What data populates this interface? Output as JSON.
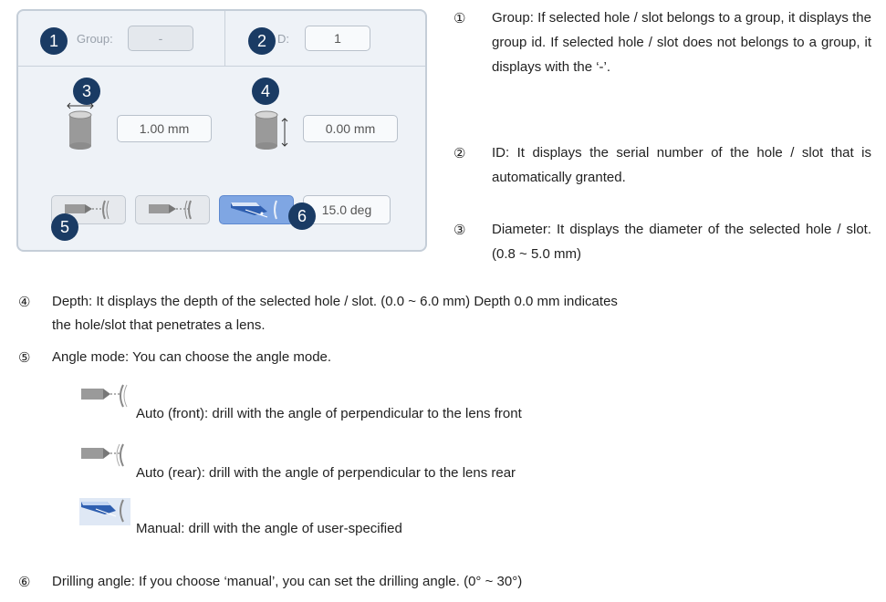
{
  "panel": {
    "group_label": "Group:",
    "group_value": "-",
    "id_label": "D:",
    "id_value": "1",
    "diameter_value": "1.00 mm",
    "depth_value": "0.00 mm",
    "angle_value": "15.0 deg",
    "badges": [
      "1",
      "2",
      "3",
      "4",
      "5",
      "6"
    ],
    "colors": {
      "badge": "#1a3b64",
      "active_button": "#7fa6e3",
      "panel_bg": "#eef2f7"
    }
  },
  "descriptions": [
    {
      "num": "①",
      "text": "Group: If selected hole / slot belongs to a group, it displays the group id. If selected hole / slot does not belongs to a group, it displays with the ‘-’."
    },
    {
      "num": "②",
      "text": "ID: It displays the serial number of the hole / slot that is automatically granted."
    },
    {
      "num": "③",
      "text": "Diameter: It displays the diameter of the selected hole / slot. (0.8 ~ 5.0 mm)"
    },
    {
      "num": "④",
      "line1": "Depth: It displays the depth of the selected hole / slot. (0.0 ~ 6.0 mm)  Depth 0.0 mm indicates",
      "line2": "the hole/slot that penetrates a lens."
    },
    {
      "num": "⑤",
      "text": "Angle mode: You can choose the angle mode."
    },
    {
      "num": "⑥",
      "text": "Drilling angle: If you choose ‘manual’, you can set the drilling angle. (0° ~ 30°)"
    }
  ],
  "angle_modes": [
    {
      "icon": "auto-front-icon",
      "text": "Auto (front): drill with the angle of perpendicular to the lens front"
    },
    {
      "icon": "auto-rear-icon",
      "text": "Auto (rear): drill with the angle of perpendicular to the lens rear"
    },
    {
      "icon": "manual-angle-icon",
      "text": "Manual: drill with the angle of user-specified"
    }
  ]
}
